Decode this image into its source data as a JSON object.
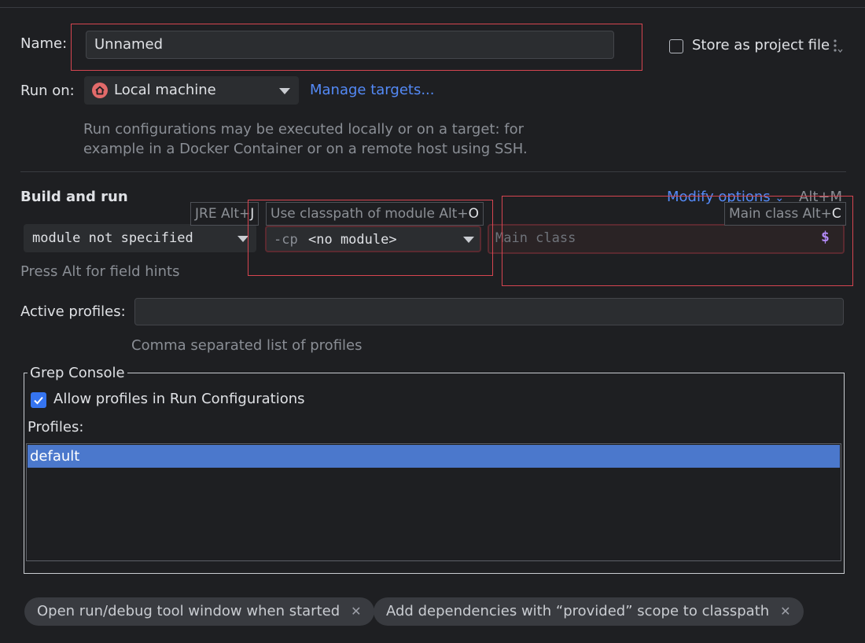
{
  "name": {
    "label": "Name:",
    "value": "Unnamed"
  },
  "store": {
    "label": "Store as project file"
  },
  "run_on": {
    "label": "Run on:",
    "value": "Local machine",
    "manage_link": "Manage targets..."
  },
  "description": {
    "line1": "Run configurations may be executed locally or on a target: for",
    "line2": "example in a Docker Container or on a remote host using SSH."
  },
  "build": {
    "title": "Build and run",
    "modify": "Modify options",
    "modify_shortcut": "Alt+M",
    "jre_value": "module not specified",
    "cp_prefix": "-cp",
    "cp_value": "<no module>",
    "main_class_placeholder": "Main class",
    "field_hint": "Press Alt for field hints",
    "tips": {
      "jre": {
        "text": "JRE Alt+",
        "key": "J"
      },
      "cp": {
        "text": "Use classpath of module Alt+",
        "key": "O"
      },
      "main": {
        "text": "Main class Alt+",
        "key": "C"
      }
    }
  },
  "profiles": {
    "label": "Active profiles:",
    "value": "",
    "hint": "Comma separated list of profiles"
  },
  "grep": {
    "title": "Grep Console",
    "allow_label": "Allow profiles in Run Configurations",
    "allow_checked": true,
    "profiles_label": "Profiles:",
    "items": [
      "default"
    ]
  },
  "chips": [
    {
      "label": "Open run/debug tool window when started"
    },
    {
      "label": "Add dependencies with “provided” scope to classpath"
    }
  ],
  "colors": {
    "background": "#1e1f22",
    "accent": "#3574f0",
    "link": "#548af7",
    "highlight_box": "#d64550",
    "selection": "#4b78cc"
  },
  "icons": {
    "home": "house-icon",
    "options": "vertical-dots-icon",
    "macro": "dollar-icon",
    "close": "close-icon"
  }
}
